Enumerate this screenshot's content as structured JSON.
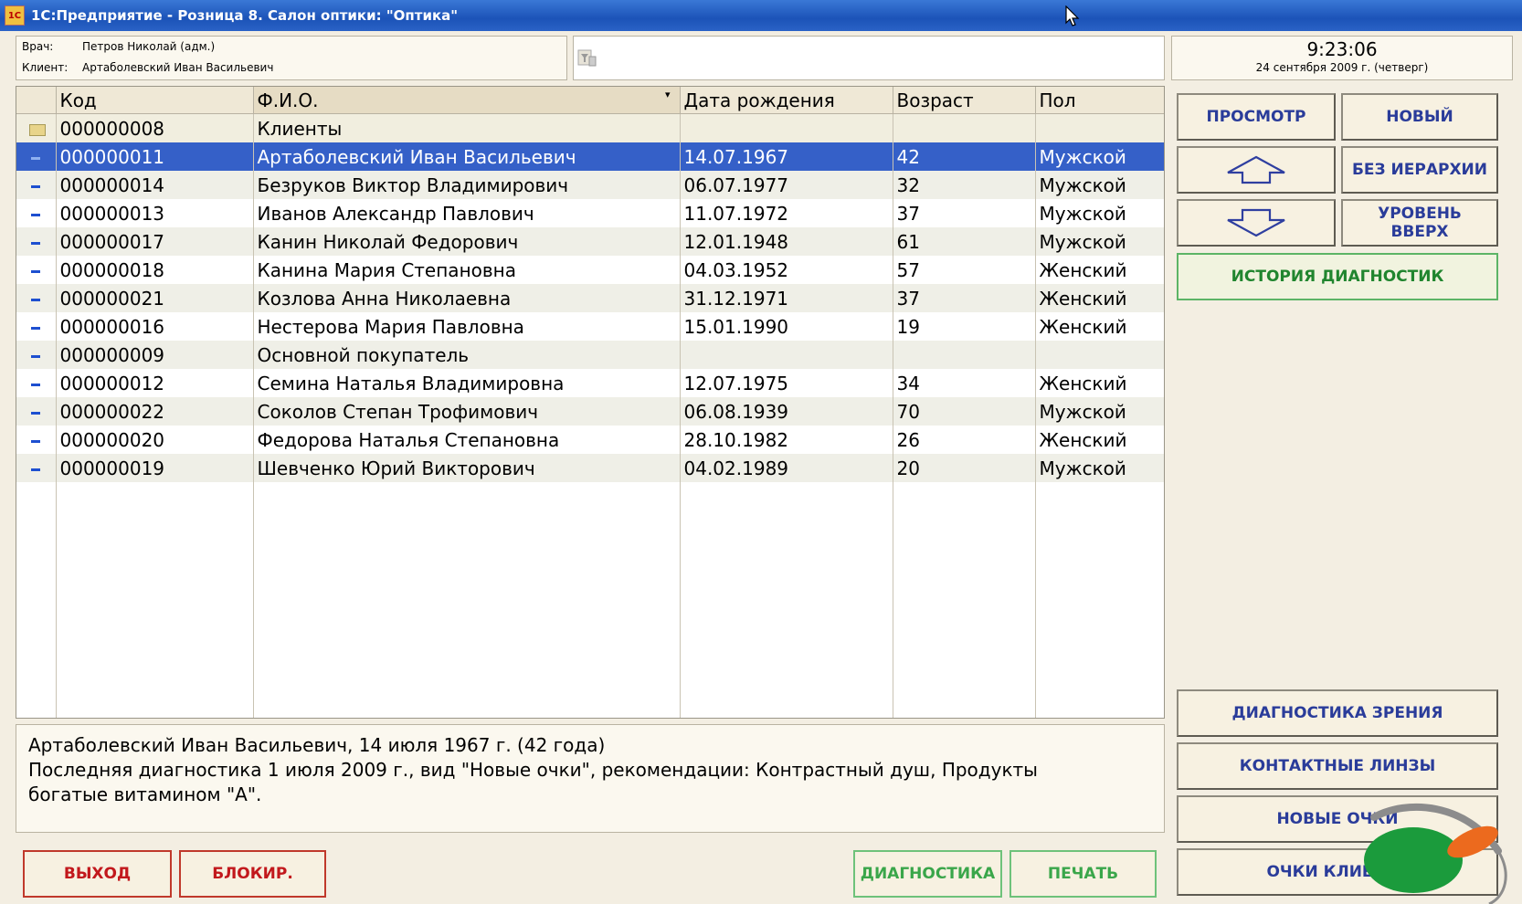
{
  "window": {
    "title": "1С:Предприятие - Розница 8. Салон оптики: \"Оптика\"",
    "icon": "1c-app-icon"
  },
  "info": {
    "doctor_label": "Врач:",
    "doctor_value": "Петров Николай (адм.)",
    "client_label": "Клиент:",
    "client_value": "Артаболевский Иван Васильевич"
  },
  "search": {
    "value": "",
    "icon": "filter-icon"
  },
  "clock": {
    "time": "9:23:06",
    "date": "24 сентября 2009 г. (четверг)"
  },
  "table": {
    "headers": [
      "Код",
      "Ф.И.О.",
      "Дата рождения",
      "Возраст",
      "Пол"
    ],
    "rows": [
      {
        "mark": "folder",
        "code": "000000008",
        "name": "Клиенты",
        "dob": "",
        "age": "",
        "sex": ""
      },
      {
        "mark": "item",
        "code": "000000011",
        "name": "Артаболевский Иван Васильевич",
        "dob": "14.07.1967",
        "age": "42",
        "sex": "Мужской"
      },
      {
        "mark": "item",
        "code": "000000014",
        "name": "Безруков Виктор Владимирович",
        "dob": "06.07.1977",
        "age": "32",
        "sex": "Мужской"
      },
      {
        "mark": "item",
        "code": "000000013",
        "name": "Иванов Александр Павлович",
        "dob": "11.07.1972",
        "age": "37",
        "sex": "Мужской"
      },
      {
        "mark": "item",
        "code": "000000017",
        "name": "Канин Николай Федорович",
        "dob": "12.01.1948",
        "age": "61",
        "sex": "Мужской"
      },
      {
        "mark": "item",
        "code": "000000018",
        "name": "Канина Мария Степановна",
        "dob": "04.03.1952",
        "age": "57",
        "sex": "Женский"
      },
      {
        "mark": "item",
        "code": "000000021",
        "name": "Козлова Анна Николаевна",
        "dob": "31.12.1971",
        "age": "37",
        "sex": "Женский"
      },
      {
        "mark": "item",
        "code": "000000016",
        "name": "Нестерова Мария Павловна",
        "dob": "15.01.1990",
        "age": "19",
        "sex": "Женский"
      },
      {
        "mark": "item",
        "code": "000000009",
        "name": "Основной покупатель",
        "dob": "",
        "age": "",
        "sex": ""
      },
      {
        "mark": "item",
        "code": "000000012",
        "name": "Семина Наталья Владимировна",
        "dob": "12.07.1975",
        "age": "34",
        "sex": "Женский"
      },
      {
        "mark": "item",
        "code": "000000022",
        "name": "Соколов Степан Трофимович",
        "dob": "06.08.1939",
        "age": "70",
        "sex": "Мужской"
      },
      {
        "mark": "item",
        "code": "000000020",
        "name": "Федорова Наталья Степановна",
        "dob": "28.10.1982",
        "age": "26",
        "sex": "Женский"
      },
      {
        "mark": "item",
        "code": "000000019",
        "name": "Шевченко Юрий Викторович",
        "dob": "04.02.1989",
        "age": "20",
        "sex": "Мужской"
      }
    ],
    "selected_index": 1
  },
  "summary": {
    "line1": "Артаболевский Иван Васильевич, 14 июля 1967 г. (42 года)",
    "line2": "Последняя диагностика 1 июля 2009 г., вид \"Новые очки\", рекомендации: Контрастный душ, Продукты",
    "line3": "богатые витамином \"А\"."
  },
  "buttons": {
    "view": "ПРОСМОТР",
    "new": "НОВЫЙ",
    "up_icon": "arrow-up-icon",
    "down_icon": "arrow-down-icon",
    "no_hierarchy": "БЕЗ ИЕРАРХИИ",
    "level_up_1": "УРОВЕНЬ",
    "level_up_2": "ВВЕРХ",
    "history": "ИСТОРИЯ ДИАГНОСТИК",
    "vision_diag": "ДИАГНОСТИКА ЗРЕНИЯ",
    "contact_lenses": "КОНТАКТНЫЕ ЛИНЗЫ",
    "new_glasses": "НОВЫЕ ОЧКИ",
    "client_glasses": "ОЧКИ КЛИЕНТА",
    "exit": "ВЫХОД",
    "block": "БЛОКИР.",
    "diagnostics": "ДИАГНОСТИКА",
    "print": "ПЕЧАТЬ"
  },
  "colors": {
    "titlebar": "#1c53b8",
    "selection": "#3560c8",
    "button_text_blue": "#2a3c9a",
    "button_text_red": "#c2181c",
    "button_text_green": "#3aa64a"
  }
}
